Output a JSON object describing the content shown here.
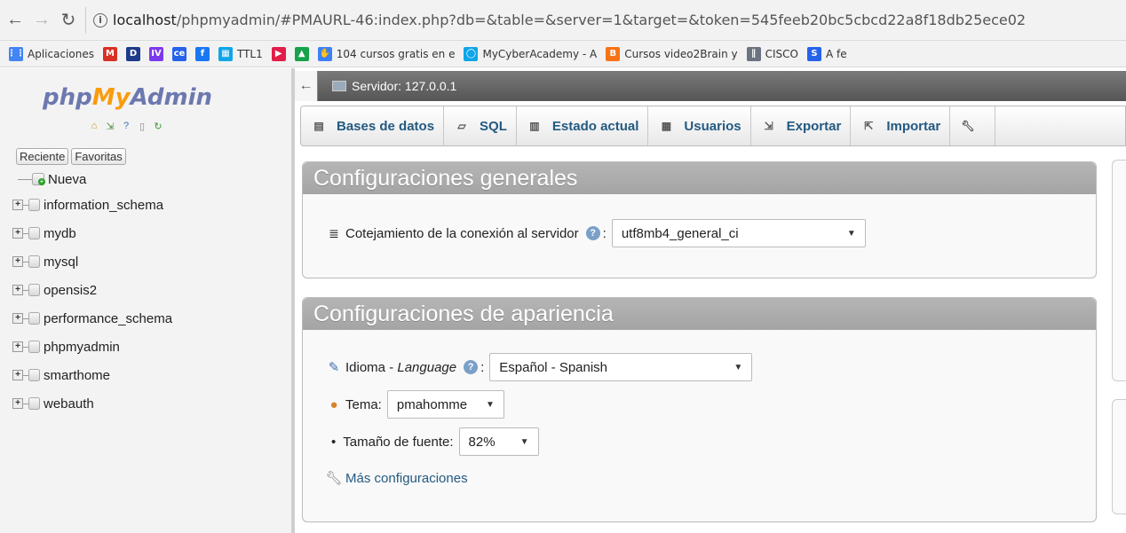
{
  "browser": {
    "url_host": "localhost",
    "url_rest": "/phpmyadmin/#PMAURL-46:index.php?db=&table=&server=1&target=&token=545feeb20bc5cbcd22a8f18db25ece02",
    "bookmarks": [
      {
        "label": "Aplicaciones",
        "icon": "apps-grid-icon",
        "color": "#4285f4",
        "glyph": "⋮⋮"
      },
      {
        "label": "",
        "icon": "gmail-icon",
        "color": "#d93025",
        "glyph": "M"
      },
      {
        "label": "",
        "icon": "bookmark-d-icon",
        "color": "#1e3a8a",
        "glyph": "D"
      },
      {
        "label": "",
        "icon": "bookmark-iv-icon",
        "color": "#7c3aed",
        "glyph": "IV"
      },
      {
        "label": "",
        "icon": "bookmark-ce-icon",
        "color": "#2563eb",
        "glyph": "ce"
      },
      {
        "label": "",
        "icon": "facebook-icon",
        "color": "#1877f2",
        "glyph": "f"
      },
      {
        "label": "TTL1",
        "icon": "ttl-icon",
        "color": "#0ea5e9",
        "glyph": "▦"
      },
      {
        "label": "",
        "icon": "youtube-icon",
        "color": "#e11d48",
        "glyph": "▶"
      },
      {
        "label": "",
        "icon": "drive-icon",
        "color": "#16a34a",
        "glyph": "▲"
      },
      {
        "label": "104 cursos gratis en e",
        "icon": "cursos-icon",
        "color": "#3b82f6",
        "glyph": "✋"
      },
      {
        "label": "MyCyberAcademy - A",
        "icon": "cyberacademy-icon",
        "color": "#0ea5e9",
        "glyph": "◯"
      },
      {
        "label": "Cursos video2Brain y",
        "icon": "blogger-icon",
        "color": "#f97316",
        "glyph": "B"
      },
      {
        "label": "CISCO",
        "icon": "cisco-icon",
        "color": "#6b7280",
        "glyph": "∥"
      },
      {
        "label": "A fe",
        "icon": "soc-icon",
        "color": "#2563eb",
        "glyph": "S"
      }
    ]
  },
  "sidebar": {
    "logo": {
      "php": "php",
      "my": "My",
      "admin": "Admin"
    },
    "tabs": [
      "Reciente",
      "Favoritas"
    ],
    "new_label": "Nueva",
    "databases": [
      "information_schema",
      "mydb",
      "mysql",
      "opensis2",
      "performance_schema",
      "phpmyadmin",
      "smarthome",
      "webauth"
    ]
  },
  "server_bar": {
    "label": "Servidor: 127.0.0.1"
  },
  "menu": {
    "tabs": [
      {
        "label": "Bases de datos",
        "icon": "database-icon"
      },
      {
        "label": "SQL",
        "icon": "sql-icon"
      },
      {
        "label": "Estado actual",
        "icon": "status-chart-icon"
      },
      {
        "label": "Usuarios",
        "icon": "users-icon"
      },
      {
        "label": "Exportar",
        "icon": "export-icon"
      },
      {
        "label": "Importar",
        "icon": "import-icon"
      }
    ]
  },
  "general": {
    "title": "Configuraciones generales",
    "collation_label": "Cotejamiento de la conexión al servidor",
    "collation_value": "utf8mb4_general_ci"
  },
  "appearance": {
    "title": "Configuraciones de apariencia",
    "lang_label": "Idioma - ",
    "lang_label_em": "Language",
    "lang_value": "Español - Spanish",
    "theme_label": "Tema:",
    "theme_value": "pmahomme",
    "font_label": "Tamaño de fuente:",
    "font_value": "82%",
    "more_label": "Más configuraciones"
  },
  "colors": {
    "link": "#235a81",
    "panel_header": "#a9a9a9",
    "server_bar": "#666666"
  }
}
